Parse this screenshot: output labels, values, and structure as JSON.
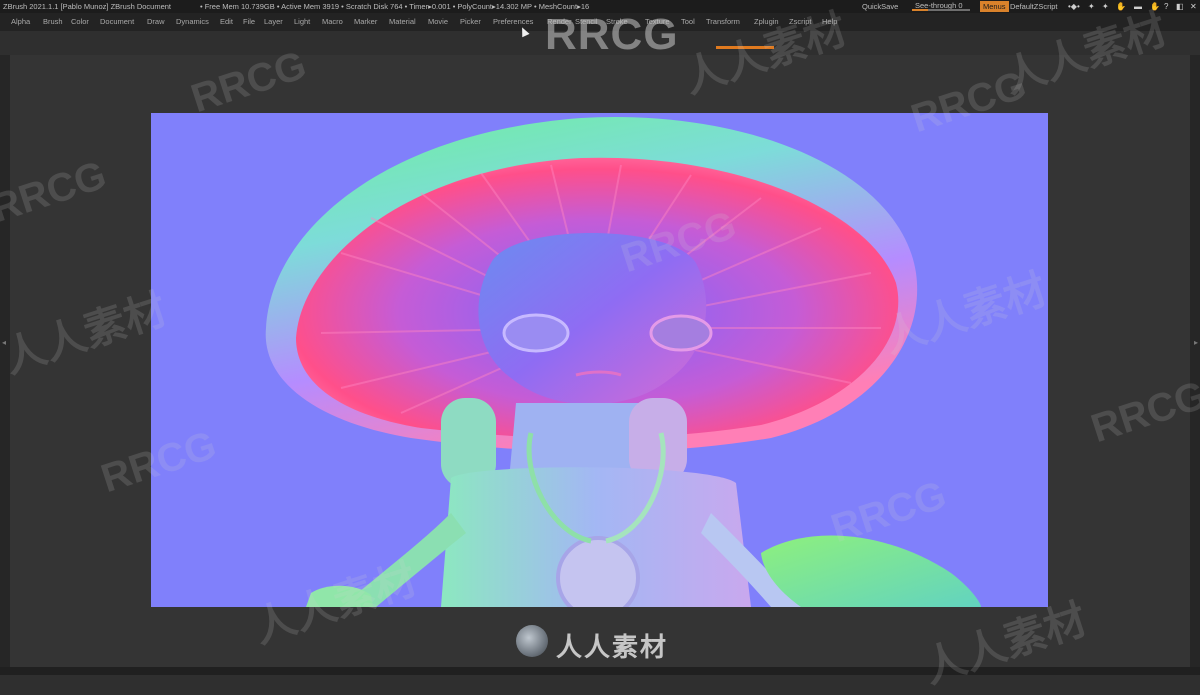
{
  "titlebar": {
    "app_title": "ZBrush 2021.1.1 [Pablo Munoz]   ZBrush Document",
    "stats": "• Free Mem 10.739GB • Active Mem 3919 • Scratch Disk 764 • Timer▸0.001 • PolyCount▸14.302 MP • MeshCount▸16",
    "quicksave": "QuickSave",
    "seethrough": "See-through  0",
    "menus": "Menus",
    "defaultzscript": "DefaultZScript"
  },
  "menubar": {
    "items": [
      "Alpha",
      "Brush",
      "Color",
      "Document",
      "Draw",
      "Dynamics",
      "Edit",
      "File",
      "Layer",
      "Light",
      "Macro",
      "Marker",
      "Material",
      "Movie",
      "Picker",
      "Preferences",
      "Render",
      "Stencil",
      "Stroke",
      "Texture",
      "Tool",
      "Transform",
      "Zplugin",
      "Zscript",
      "Help"
    ]
  },
  "watermark": {
    "top_logo": "RRCG",
    "tiles_en": "RRCG",
    "tiles_cn": "人人素材",
    "bottom_logo": "人人素材"
  },
  "colors": {
    "accent": "#e07a1f",
    "canvas_bg": "#8080fb",
    "ui_bg": "#2f2f2f"
  },
  "icons": [
    "maximize-icon",
    "close-icon",
    "minimize-icon",
    "help-icon"
  ]
}
